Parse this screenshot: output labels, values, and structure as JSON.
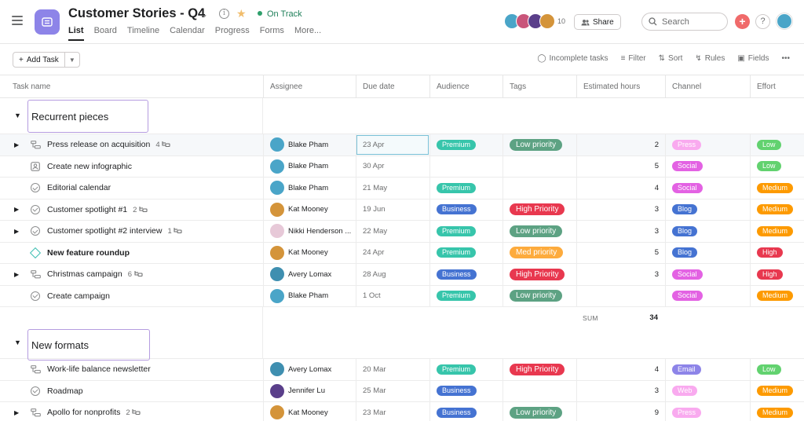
{
  "header": {
    "title": "Customer Stories - Q4",
    "status": "On Track",
    "tabs": [
      "List",
      "Board",
      "Timeline",
      "Calendar",
      "Progress",
      "Forms",
      "More..."
    ],
    "member_count": "10",
    "share_label": "Share",
    "search_placeholder": "Search",
    "help_label": "?"
  },
  "toolbar": {
    "add_task_label": "Add Task",
    "incomplete_label": "Incomplete tasks",
    "filter_label": "Filter",
    "sort_label": "Sort",
    "rules_label": "Rules",
    "fields_label": "Fields"
  },
  "columns": [
    "Task name",
    "Assignee",
    "Due date",
    "Audience",
    "Tags",
    "Estimated hours",
    "Channel",
    "Effort"
  ],
  "colors": {
    "premium": "#37c5ab",
    "business": "#4573d2",
    "low_priority": "#5da283",
    "high_priority": "#e8384f",
    "med_priority": "#fdab3d",
    "press": "#f9aaef",
    "social": "#e362e3",
    "blog": "#4573d2",
    "email": "#8d84e8",
    "web": "#f9aaef",
    "effort_low": "#62d26f",
    "effort_medium": "#fd9a00",
    "effort_high": "#e8384f"
  },
  "sections": [
    {
      "title": "Recurrent pieces",
      "tasks": [
        {
          "name": "Press release on acquisition",
          "subtasks": "4",
          "icon": "subtask-icon",
          "expandable": true,
          "assignee": "Blake Pham",
          "avatar": "#4aa5c8",
          "due": "23 Apr",
          "audience": "Premium",
          "tag": "Low priority",
          "hours": "2",
          "channel": "Press",
          "effort": "Low"
        },
        {
          "name": "Create new infographic",
          "subtasks": "",
          "icon": "approval-icon",
          "expandable": false,
          "assignee": "Blake Pham",
          "avatar": "#4aa5c8",
          "due": "30 Apr",
          "audience": "",
          "tag": "",
          "hours": "5",
          "channel": "Social",
          "effort": "Low"
        },
        {
          "name": "Editorial calendar",
          "subtasks": "",
          "icon": "check-circle-icon",
          "expandable": false,
          "assignee": "Blake Pham",
          "avatar": "#4aa5c8",
          "due": "21 May",
          "audience": "Premium",
          "tag": "",
          "hours": "4",
          "channel": "Social",
          "effort": "Medium"
        },
        {
          "name": "Customer spotlight #1",
          "subtasks": "2",
          "icon": "check-circle-icon",
          "expandable": true,
          "assignee": "Kat Mooney",
          "avatar": "#d4943a",
          "due": "19 Jun",
          "audience": "Business",
          "tag": "High Priority",
          "hours": "3",
          "channel": "Blog",
          "effort": "Medium"
        },
        {
          "name": "Customer spotlight #2 interview",
          "subtasks": "1",
          "icon": "check-circle-icon",
          "expandable": true,
          "assignee": "Nikki Henderson ...",
          "avatar": "#e7c9d8",
          "due": "22 May",
          "audience": "Premium",
          "tag": "Low priority",
          "hours": "3",
          "channel": "Blog",
          "effort": "Medium"
        },
        {
          "name": "New feature roundup",
          "subtasks": "",
          "icon": "milestone-icon",
          "expandable": false,
          "bold": true,
          "assignee": "Kat Mooney",
          "avatar": "#d4943a",
          "due": "24 Apr",
          "audience": "Premium",
          "tag": "Med priority",
          "hours": "5",
          "channel": "Blog",
          "effort": "High"
        },
        {
          "name": "Christmas campaign",
          "subtasks": "6",
          "icon": "subtask-icon",
          "expandable": true,
          "assignee": "Avery Lomax",
          "avatar": "#3f8fb0",
          "due": "28 Aug",
          "audience": "Business",
          "tag": "High Priority",
          "hours": "3",
          "channel": "Social",
          "effort": "High"
        },
        {
          "name": "Create campaign",
          "subtasks": "",
          "icon": "check-circle-icon",
          "expandable": false,
          "assignee": "Blake Pham",
          "avatar": "#4aa5c8",
          "due": "1 Oct",
          "audience": "Premium",
          "tag": "Low priority",
          "hours": "",
          "channel": "Social",
          "effort": "Medium"
        }
      ],
      "sum_label": "SUM",
      "sum_value": "34"
    },
    {
      "title": "New formats",
      "tasks": [
        {
          "name": "Work-life balance newsletter",
          "subtasks": "",
          "icon": "subtask-icon",
          "expandable": false,
          "assignee": "Avery Lomax",
          "avatar": "#3f8fb0",
          "due": "20 Mar",
          "audience": "Premium",
          "tag": "High Priority",
          "hours": "4",
          "channel": "Email",
          "effort": "Low"
        },
        {
          "name": "Roadmap",
          "subtasks": "",
          "icon": "check-circle-icon",
          "expandable": false,
          "assignee": "Jennifer Lu",
          "avatar": "#5a3f8a",
          "due": "25 Mar",
          "audience": "Business",
          "tag": "",
          "hours": "3",
          "channel": "Web",
          "effort": "Medium"
        },
        {
          "name": "Apollo for nonprofits",
          "subtasks": "2",
          "icon": "subtask-icon",
          "expandable": true,
          "assignee": "Kat Mooney",
          "avatar": "#d4943a",
          "due": "23 Mar",
          "audience": "Business",
          "tag": "Low priority",
          "hours": "9",
          "channel": "Press",
          "effort": "Medium"
        }
      ]
    }
  ]
}
